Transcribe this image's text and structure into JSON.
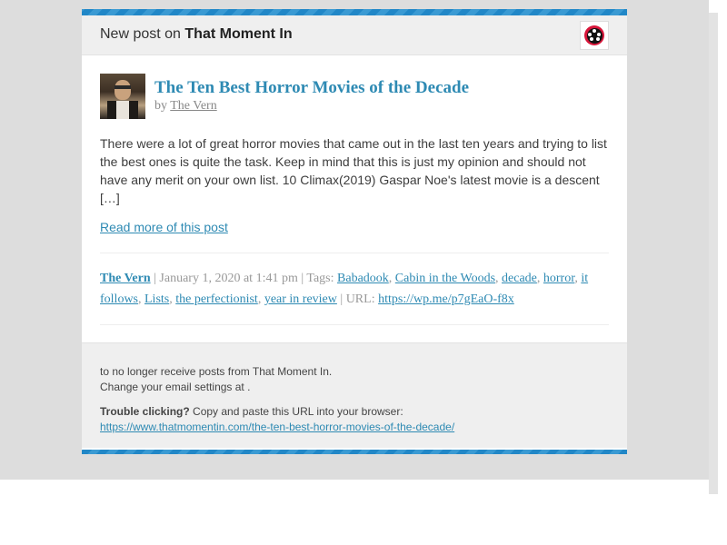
{
  "header": {
    "prefix": "New post on ",
    "site_name": "That Moment In",
    "icon": "film-reel-icon"
  },
  "post": {
    "title": "The Ten Best Horror Movies of the Decade",
    "by_prefix": "by ",
    "author": "The Vern",
    "excerpt": "There were a lot of great horror movies that came out in the last ten years and trying to list the best ones is quite the task.  Keep in mind that this is just my opinion and should not have any merit on your own list.  10 Climax(2019) Gaspar Noe's latest movie is a descent […]",
    "read_more": "Read more of this post"
  },
  "meta": {
    "author": "The Vern",
    "date_text": " | January 1, 2020 at 1:41 pm | Tags: ",
    "tags": [
      "Babadook",
      "Cabin in the Woods",
      "decade",
      "horror",
      "it follows",
      "Lists",
      "the perfectionist",
      "year in review"
    ],
    "url_label": " | URL: ",
    "url": "https://wp.me/p7gEaO-f8x"
  },
  "footer": {
    "unsubscribe_text": "to no longer receive posts from That Moment In.",
    "settings_text": "Change your email settings at .",
    "trouble_bold": "Trouble clicking?",
    "trouble_text": " Copy and paste this URL into your browser:",
    "post_url": "https://www.thatmomentin.com/the-ten-best-horror-movies-of-the-decade/"
  },
  "colors": {
    "link": "#2e8ab3",
    "accent_border": "#2187c7",
    "header_bg": "#efefef",
    "page_bg": "#dddddd"
  }
}
